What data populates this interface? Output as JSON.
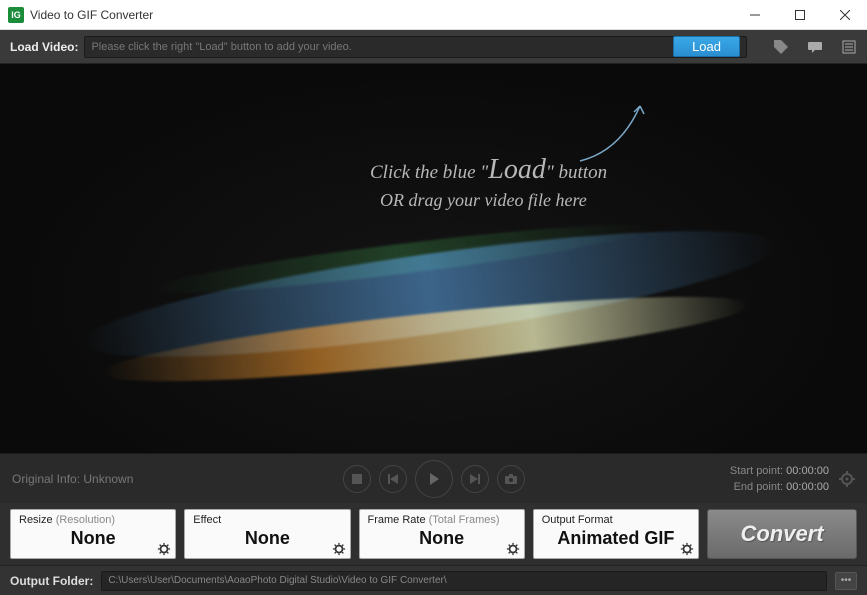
{
  "window": {
    "title": "Video to GIF Converter",
    "icon_text": "IG"
  },
  "load_bar": {
    "label": "Load Video:",
    "placeholder": "Please click the right \"Load\" button to add your video.",
    "load_button": "Load"
  },
  "hint": {
    "line1_pre": "Click the blue \"",
    "line1_big": "Load",
    "line1_post": "\" button",
    "line2": "OR drag your video file here"
  },
  "info": {
    "original": "Original Info: Unknown",
    "start_label": "Start point:",
    "start_time": "00:00:00",
    "end_label": "End point:",
    "end_time": "00:00:00"
  },
  "panels": {
    "resize": {
      "label": "Resize",
      "sub": "(Resolution)",
      "value": "None"
    },
    "effect": {
      "label": "Effect",
      "value": "None"
    },
    "framerate": {
      "label": "Frame Rate",
      "sub": "(Total Frames)",
      "value": "None"
    },
    "output_format": {
      "label": "Output Format",
      "value": "Animated GIF"
    }
  },
  "convert_button": "Convert",
  "output": {
    "label": "Output Folder:",
    "path": "C:\\Users\\User\\Documents\\AoaoPhoto Digital Studio\\Video to GIF Converter\\"
  }
}
